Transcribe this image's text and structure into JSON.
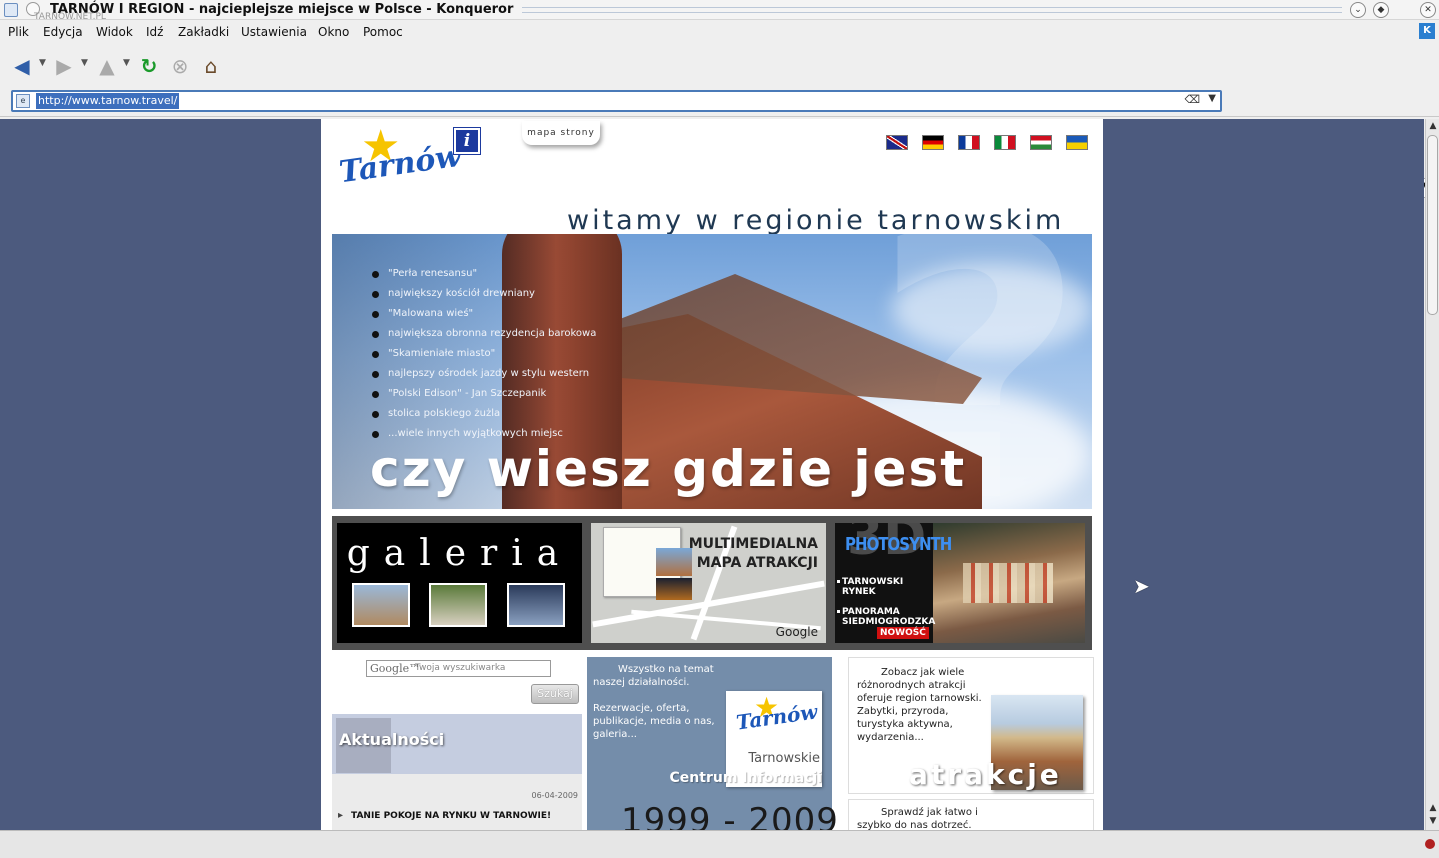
{
  "window": {
    "title": "TARNÓW I REGION - najcieplejsze miejsce w Polsce - Konqueror",
    "ghost_text": "TARNOW.NET.PL"
  },
  "menu": [
    "Plik",
    "Edycja",
    "Widok",
    "Idź",
    "Zakładki",
    "Ustawienia",
    "Okno",
    "Pomoc"
  ],
  "toolbar": {
    "back_icon": "arrow-left-icon",
    "forward_icon": "arrow-right-icon",
    "up_icon": "arrow-up-icon",
    "reload_icon": "reload-icon",
    "stop_icon": "stop-icon",
    "home_icon": "home-icon"
  },
  "location": {
    "url": "http://www.tarnow.travel/"
  },
  "page": {
    "logo_text": "Tarnów",
    "info_icon_text": "i",
    "sitemap": "mapa strony",
    "welcome": "witamy w regionie tarnowskim",
    "hero": {
      "items": [
        "\"Perła renesansu\"",
        "największy kościół drewniany",
        "\"Malowana wieś\"",
        "największa obronna rezydencja barokowa",
        "\"Skamieniałe miasto\"",
        "najlepszy ośrodek jazdy w stylu western",
        "\"Polski Edison\" - Jan Szczepanik",
        "stolica polskiego żużla",
        "...wiele innych wyjątkowych miejsc"
      ],
      "headline": "czy wiesz gdzie jest"
    },
    "tiles": {
      "gallery": "galeria",
      "map_line1": "MULTIMEDIALNA",
      "map_line2": "MAPA ATRAKCJI",
      "map_google": "Google",
      "three_d": "3D",
      "photosynth": "PHOTOSYNTH",
      "rynek_1": "TARNOWSKI",
      "rynek_2": "RYNEK",
      "panorama_1": "PANORAMA",
      "panorama_2": "SIEDMIOGRODZKA",
      "new_badge": "NOWOŚĆ"
    },
    "search": {
      "google": "Google™",
      "placeholder": "Twoja wyszukiwarka",
      "button": "Szukaj"
    },
    "news": {
      "title": "Aktualności",
      "date": "06-04-2009",
      "item": "TANIE POKOJE NA RYNKU W TARNOWIE!"
    },
    "center": {
      "text1": "Wszystko na temat naszej działalności.",
      "text2": "Rezerwacje, oferta, publikacje, media o nas, galeria...",
      "card_logo": "Tarnów",
      "card_label": "Tarnowskie",
      "centrum": "Centrum Informacji",
      "years": "1999 - 2009"
    },
    "attractions": {
      "text": "Zobacz jak wiele różnorodnych atrakcji oferuje region tarnowski. Zabytki, przyroda, turystyka aktywna, wydarzenia...",
      "label": "atrakcje"
    },
    "getting_here": {
      "text": "Sprawdź jak łatwo i szybko do nas dotrzeć."
    }
  },
  "colors": {
    "viewport_bg": "#4c5a7e",
    "center_box": "#748daa",
    "url_highlight": "#3d6fbd"
  }
}
